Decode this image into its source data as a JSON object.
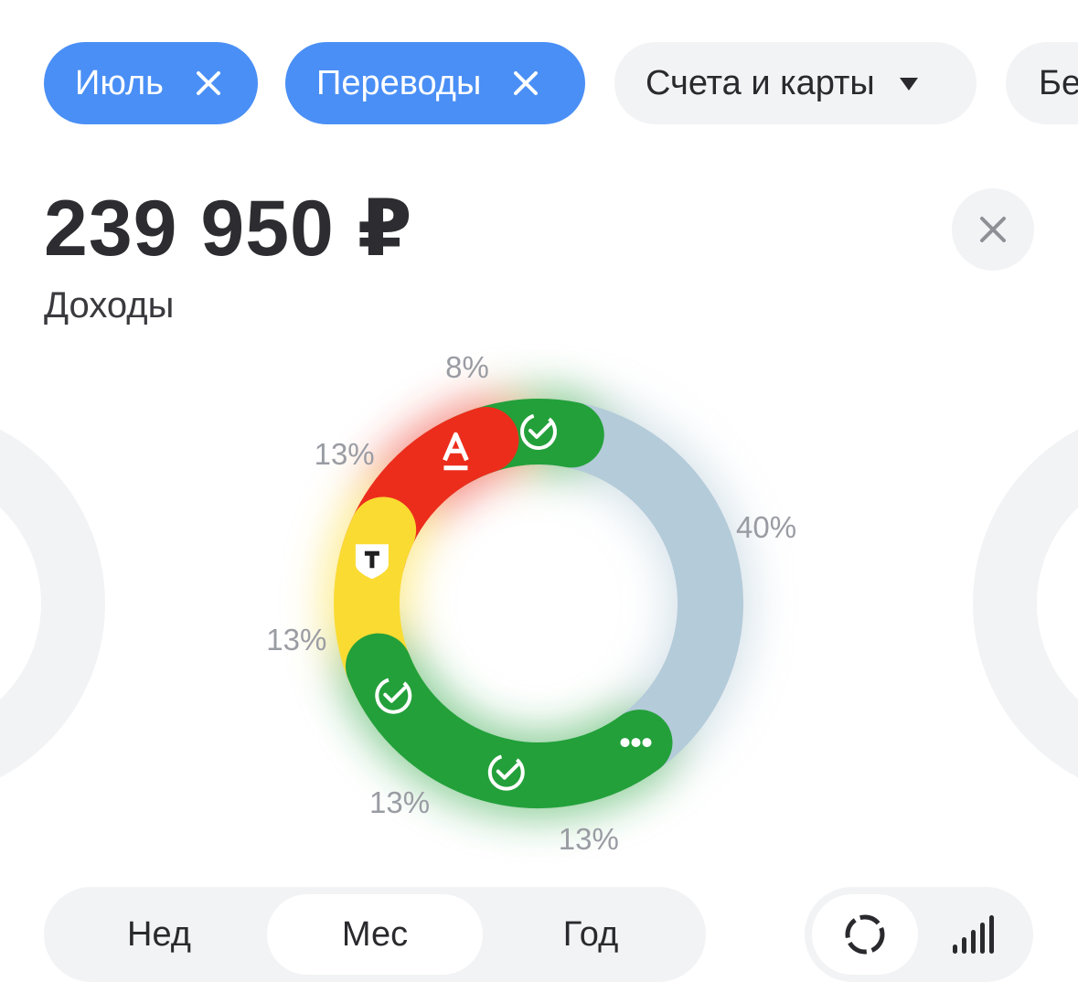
{
  "filters": {
    "chips": [
      {
        "label": "Июль",
        "state": "active"
      },
      {
        "label": "Переводы",
        "state": "active"
      },
      {
        "label": "Счета и карты",
        "state": "dropdown"
      },
      {
        "label": "Бе",
        "state": "inactive"
      }
    ]
  },
  "summary": {
    "amount": "239 950 ₽",
    "label": "Доходы"
  },
  "chart_data": {
    "type": "pie",
    "variant": "donut",
    "categories": [
      "other",
      "sber-1",
      "sber-2",
      "tbank",
      "alfa",
      "sber-3"
    ],
    "values": [
      40,
      13,
      13,
      13,
      13,
      8
    ],
    "labels": [
      "40%",
      "13%",
      "13%",
      "13%",
      "13%",
      "8%"
    ],
    "colors": [
      "#b4cbd9",
      "#23a03a",
      "#23a03a",
      "#fadb32",
      "#ec2d1c",
      "#23a03a"
    ],
    "icons": [
      "more-dots-icon",
      "sber-check-icon",
      "sber-check-icon",
      "tbank-shield-icon",
      "alfa-a-icon",
      "sber-check-icon"
    ]
  },
  "period_selector": {
    "options": [
      "Нед",
      "Мес",
      "Год"
    ],
    "selected": "Мес"
  },
  "view_toggle": {
    "options": [
      "donut-view-icon",
      "bar-view-icon"
    ],
    "selected": "donut-view-icon"
  }
}
